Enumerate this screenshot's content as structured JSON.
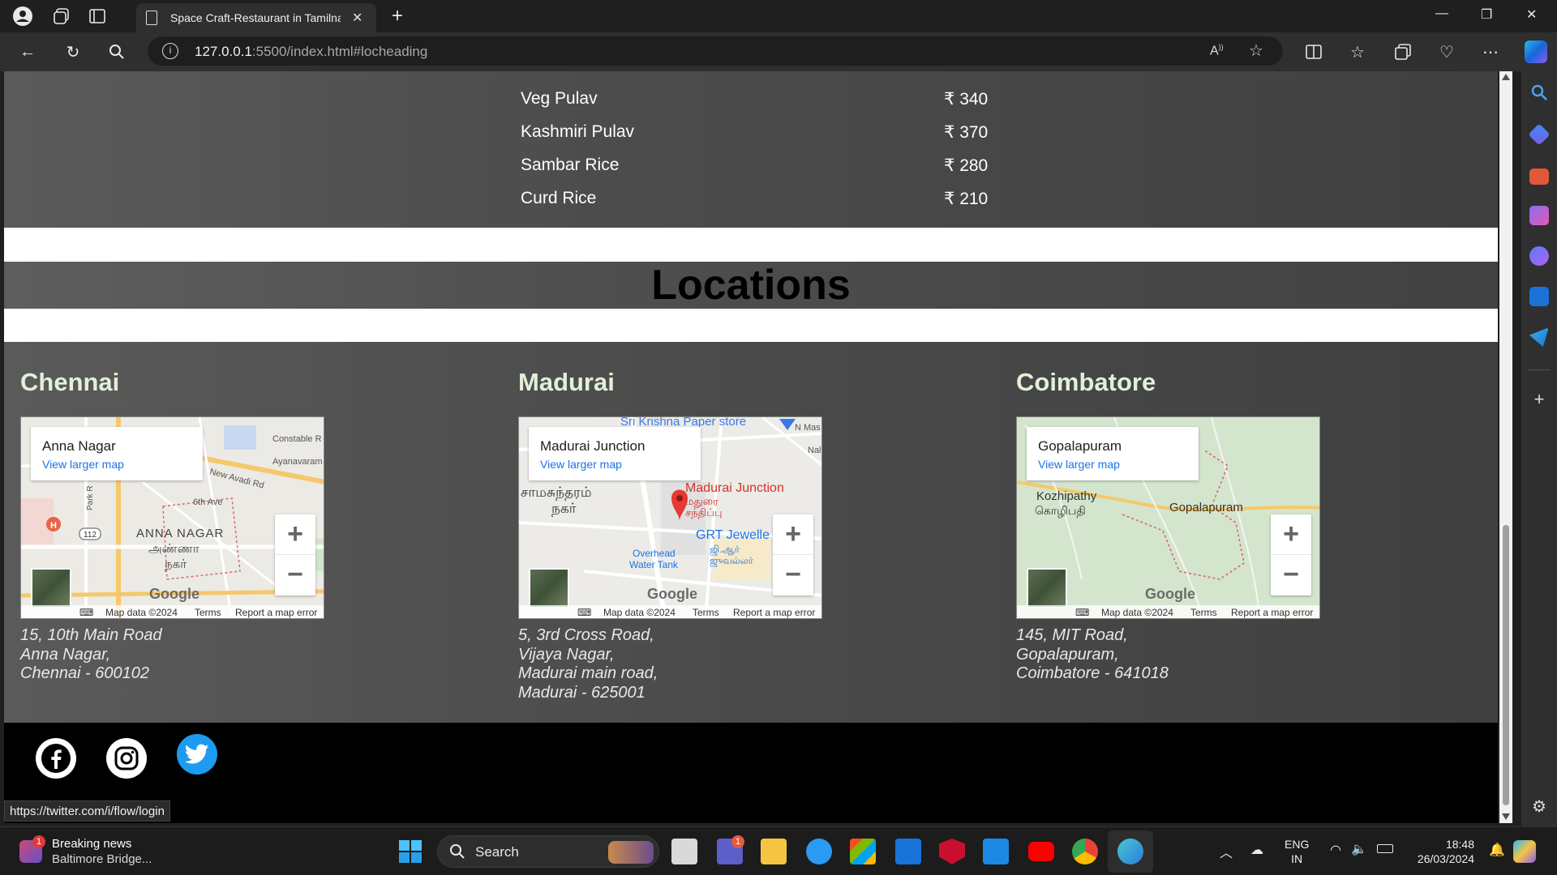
{
  "browser": {
    "tab_title": "Space Craft-Restaurant in Tamilnadu",
    "url_host": "127.0.0.1",
    "url_rest": ":5500/index.html#locheading",
    "status_url": "https://twitter.com/i/flow/login"
  },
  "menu_items": [
    {
      "name": "Veg Pulav",
      "price": "₹ 340"
    },
    {
      "name": "Kashmiri Pulav",
      "price": "₹ 370"
    },
    {
      "name": "Sambar Rice",
      "price": "₹ 280"
    },
    {
      "name": "Curd Rice",
      "price": "₹ 210"
    }
  ],
  "locations_heading": "Locations",
  "locations": [
    {
      "city": "Chennai",
      "map_place": "Anna Nagar",
      "map_link": "View larger map",
      "address": [
        "15, 10th Main Road",
        "Anna Nagar,",
        "Chennai - 600102"
      ]
    },
    {
      "city": "Madurai",
      "map_place": "Madurai Junction",
      "map_link": "View larger map",
      "address": [
        "5, 3rd Cross Road,",
        "Vijaya Nagar,",
        "Madurai main road,",
        "Madurai - 625001"
      ]
    },
    {
      "city": "Coimbatore",
      "map_place": "Gopalapuram",
      "map_link": "View larger map",
      "address": [
        "145, MIT Road,",
        "Gopalapuram,",
        "Coimbatore - 641018"
      ]
    }
  ],
  "map_labels": {
    "chennai": [
      "ANNA NAGAR",
      "அண்ணா",
      "நகர்",
      "New Avadi Rd",
      "6th Ave",
      "Constable R",
      "Ayanavaram R",
      "Park R",
      "112"
    ],
    "madurai": [
      "Sri Krishna Paper store",
      "Madurai Junction",
      "மதுரை",
      "சந்திப்பு",
      "சாமசுந்தரம்",
      "நகர்",
      "GRT Jewelle",
      "ஜி.ஆர்",
      "ஜுவல்லர்",
      "Overhead",
      "Water Tank",
      "N Mas",
      "Nal"
    ],
    "coimbatore": [
      "Kozhipathy",
      "கொழிபதி",
      "Gopalapuram"
    ]
  },
  "map_ui": {
    "google": "Google",
    "map_data": "Map data ©2024",
    "terms": "Terms",
    "report": "Report a map error"
  },
  "taskbar": {
    "news_title": "Breaking news",
    "news_sub": "Baltimore Bridge...",
    "news_badge": "1",
    "search_label": "Search",
    "lang_top": "ENG",
    "lang_bottom": "IN",
    "time": "18:48",
    "date": "26/03/2024",
    "teams_badge": "1"
  },
  "colors": {
    "city_heading": "#e2f0d8",
    "map_link": "#1a73e8",
    "twitter_blue": "#1d9bf0",
    "page_bg": "#4a4a4a"
  }
}
